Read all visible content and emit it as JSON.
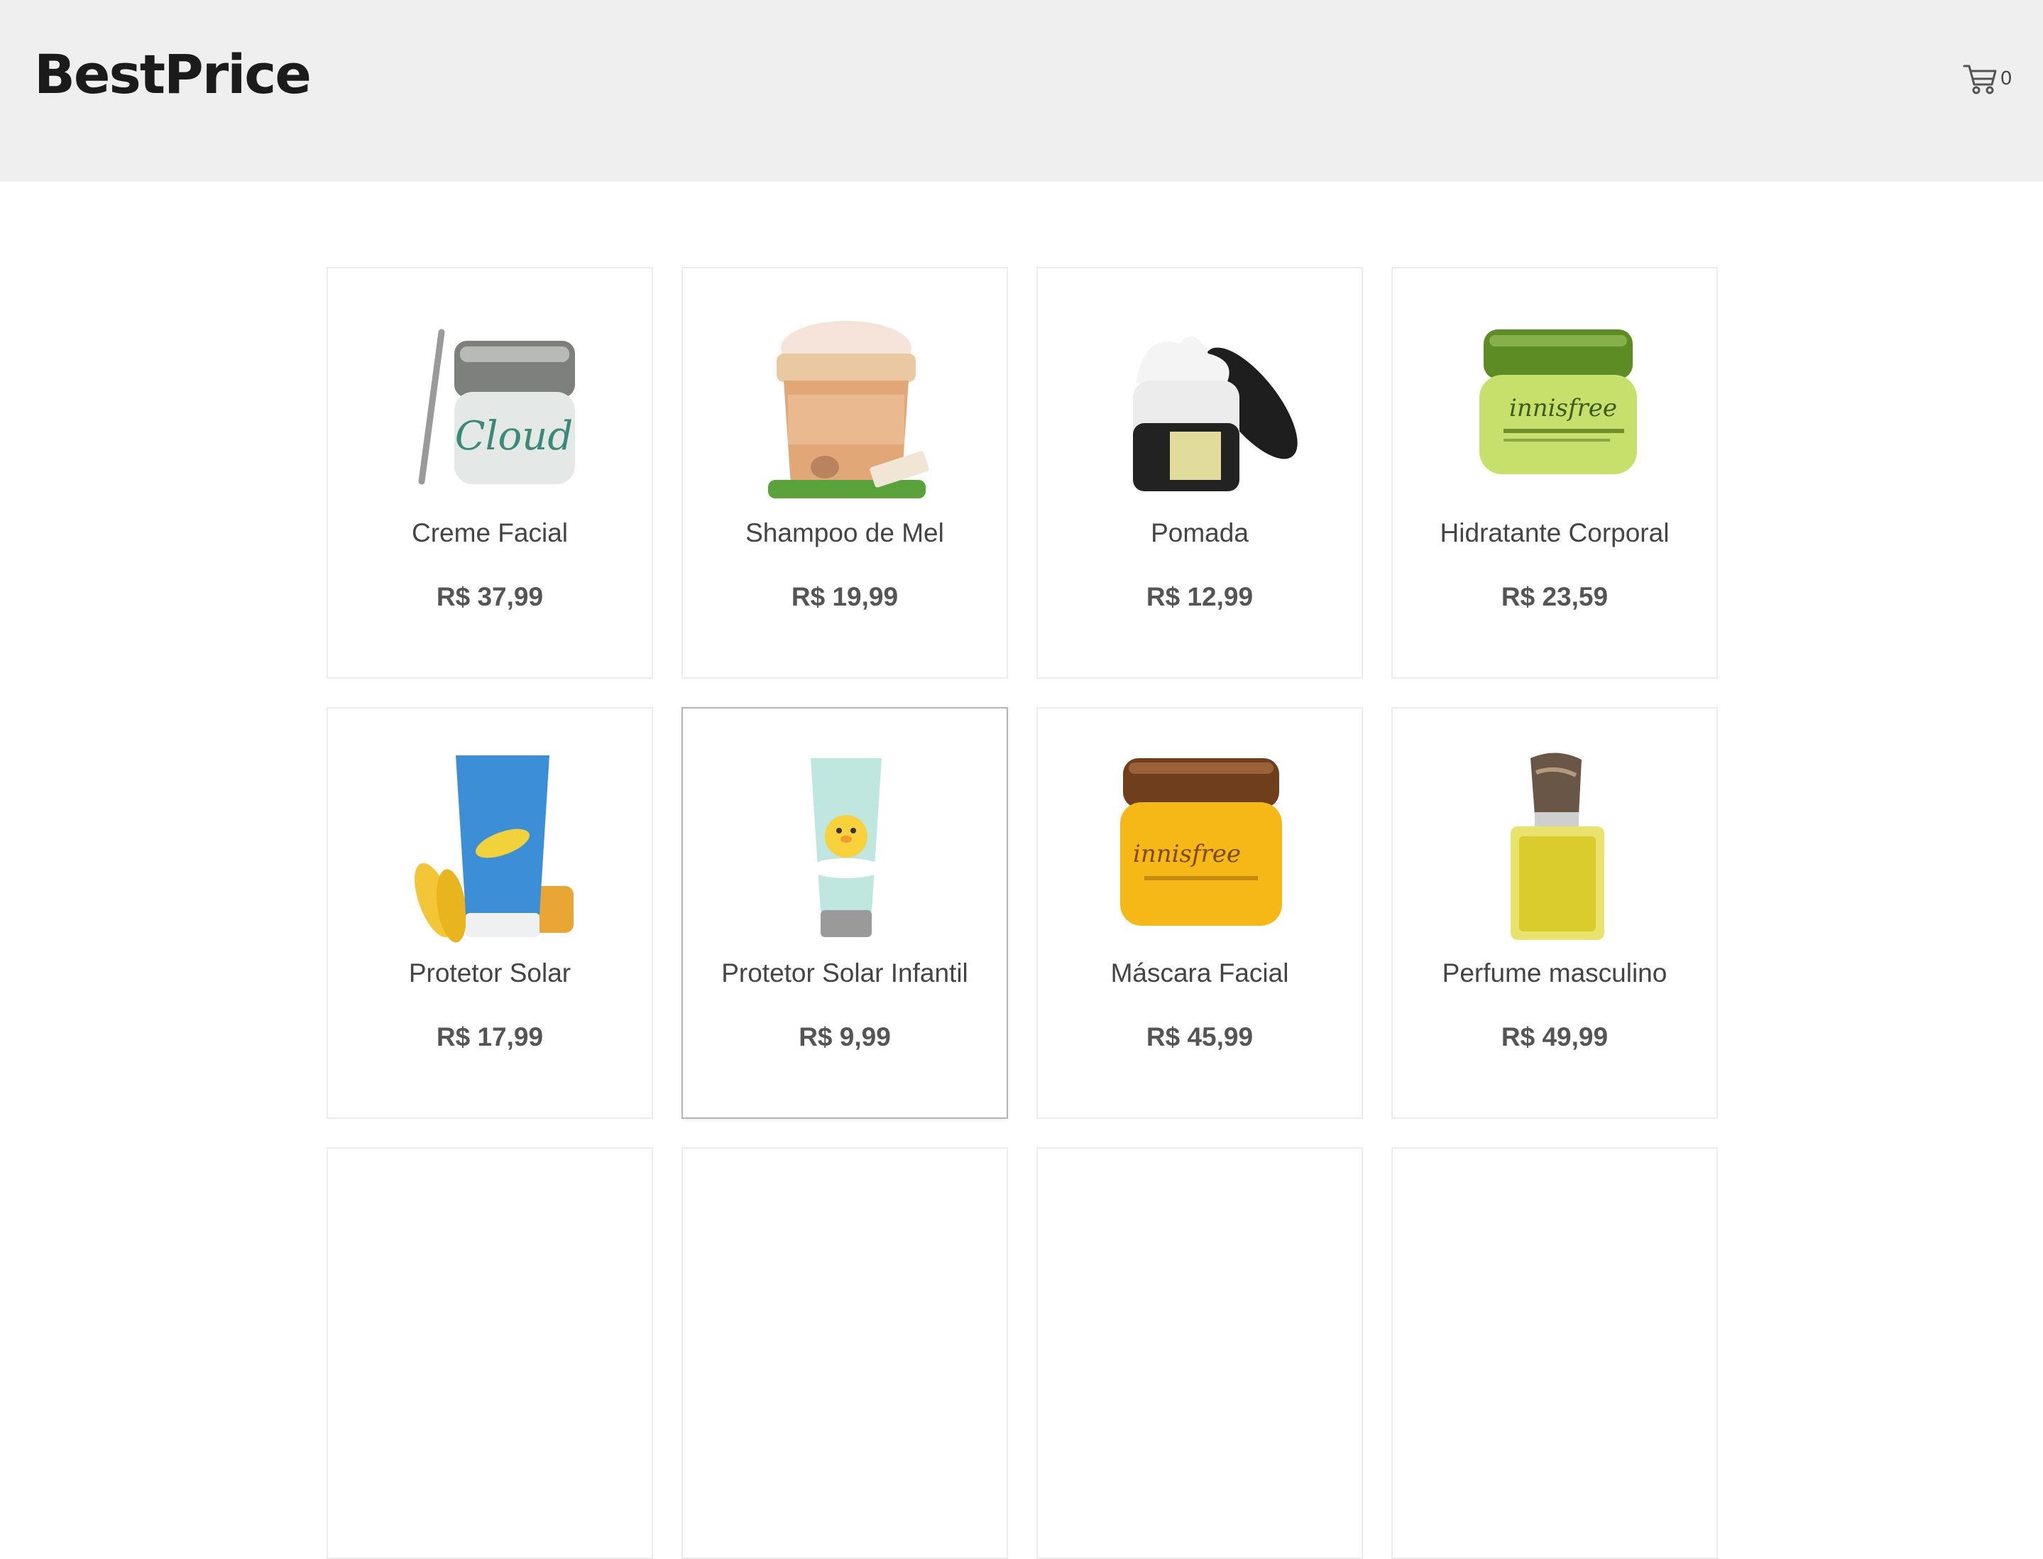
{
  "header": {
    "logo": "BestPrice",
    "cart_count": "0",
    "cart_icon": "shopping-cart-icon"
  },
  "products": [
    {
      "name": "Creme Facial",
      "price": "R$ 37,99",
      "image": "cream-jar-image"
    },
    {
      "name": "Shampoo de Mel",
      "price": "R$ 19,99",
      "image": "gel-jar-image"
    },
    {
      "name": "Pomada",
      "price": "R$ 12,99",
      "image": "ointment-jar-image"
    },
    {
      "name": "Hidratante Corporal",
      "price": "R$ 23,59",
      "image": "green-cream-jar-image"
    },
    {
      "name": "Protetor Solar",
      "price": "R$ 17,99",
      "image": "sunscreen-tube-image"
    },
    {
      "name": "Protetor Solar Infantil",
      "price": "R$ 9,99",
      "image": "kids-sunscreen-tube-image"
    },
    {
      "name": "Máscara Facial",
      "price": "R$ 45,99",
      "image": "honey-mask-jar-image"
    },
    {
      "name": "Perfume masculino",
      "price": "R$ 49,99",
      "image": "perfume-bottle-image"
    },
    {
      "name": "",
      "price": "",
      "image": ""
    },
    {
      "name": "",
      "price": "",
      "image": ""
    },
    {
      "name": "",
      "price": "",
      "image": ""
    },
    {
      "name": "",
      "price": "",
      "image": ""
    }
  ]
}
